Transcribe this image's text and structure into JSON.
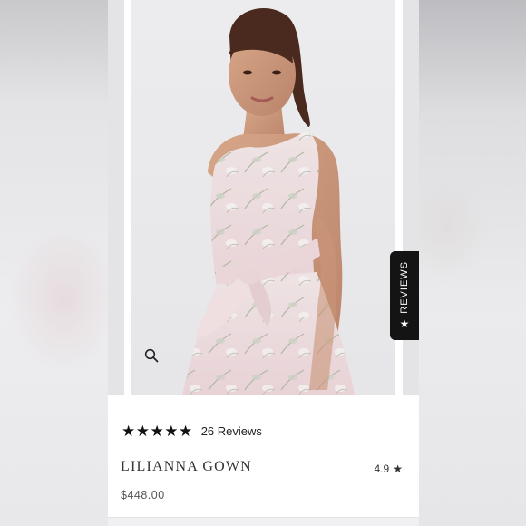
{
  "product": {
    "name": "LILIANNA GOWN",
    "price": "$448.00",
    "rating_stars": "★★★★★",
    "reviews_label": "26 Reviews",
    "average_rating": "4.9",
    "average_star": "★"
  },
  "reviews_tab": {
    "label": "REVIEWS",
    "icon": "star-icon"
  },
  "zoom": {
    "icon": "magnifier-icon"
  },
  "colors": {
    "tab_background": "#141414",
    "dress_pink": "#ecd9dc",
    "text_dark": "#222222"
  }
}
